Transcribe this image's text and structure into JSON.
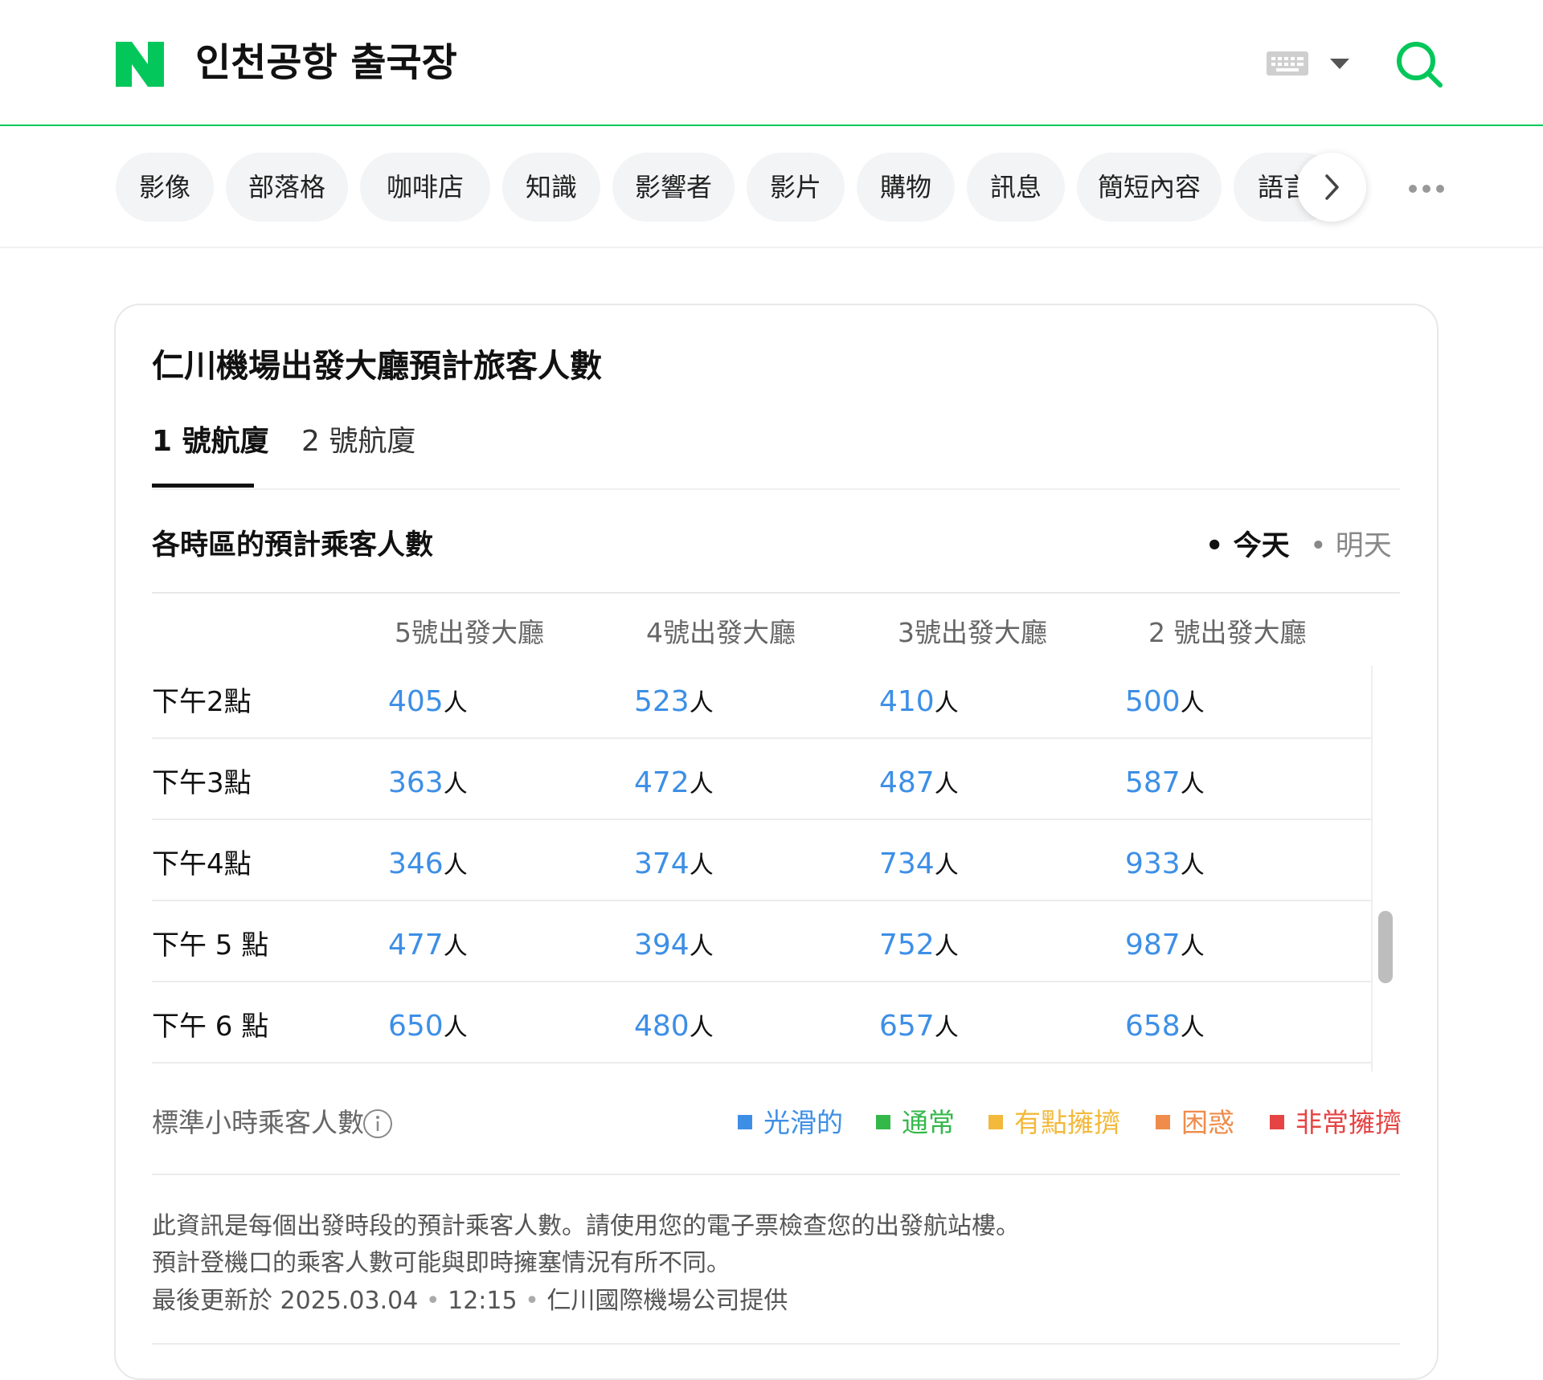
{
  "header": {
    "query": "인천공항 출국장",
    "icons": [
      "naver-logo",
      "keyboard-icon",
      "chevron-down-icon",
      "search-icon"
    ],
    "brand_color": "#03c75a"
  },
  "tabs": {
    "items": [
      "影像",
      "部落格",
      "咖啡店",
      "知識",
      "影響者",
      "影片",
      "購物",
      "訊息",
      "簡短內容",
      "語言"
    ]
  },
  "card": {
    "title": "仁川機場出發大廳預計旅客人數",
    "terminals": [
      "1 號航廈",
      "2 號航廈"
    ],
    "section_title": "各時區的預計乘客人數",
    "days": [
      "今天",
      "明天"
    ],
    "columns": [
      "5號出發大廳",
      "4號出發大廳",
      "3號出發大廳",
      "2 號出發大廳"
    ],
    "unit": "人",
    "rows": [
      {
        "label": "下午2點",
        "values": [
          "405",
          "523",
          "410",
          "500"
        ]
      },
      {
        "label": "下午3點",
        "values": [
          "363",
          "472",
          "487",
          "587"
        ]
      },
      {
        "label": "下午4點",
        "values": [
          "346",
          "374",
          "734",
          "933"
        ]
      },
      {
        "label": "下午 5 點",
        "values": [
          "477",
          "394",
          "752",
          "987"
        ]
      },
      {
        "label": "下午 6 點",
        "values": [
          "650",
          "480",
          "657",
          "658"
        ]
      }
    ],
    "standard_label": "標準小時乘客人數",
    "legend": [
      {
        "label": "光滑的",
        "color": "#3d8fe6"
      },
      {
        "label": "通常",
        "color": "#35b84a"
      },
      {
        "label": "有點擁擠",
        "color": "#f2b93b"
      },
      {
        "label": "困惑",
        "color": "#ef8c4b"
      },
      {
        "label": "非常擁擠",
        "color": "#e64444"
      }
    ],
    "notes": {
      "line1": "此資訊是每個出發時段的預計乘客人數。請使用您的電子票檢查您的出發航站樓。",
      "line2": "預計登機口的乘客人數可能與即時擁塞情況有所不同。",
      "updated_prefix": "最後更新於",
      "date": "2025.03.04",
      "time": "12:15",
      "provider": "仁川國際機場公司提供"
    }
  }
}
